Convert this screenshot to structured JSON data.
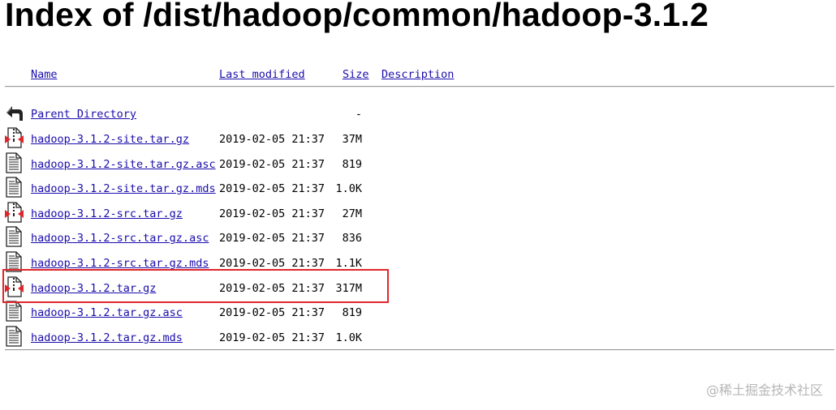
{
  "page": {
    "title": "Index of /dist/hadoop/common/hadoop-3.1.2"
  },
  "columns": {
    "name": "Name",
    "last_modified": "Last modified",
    "size": "Size",
    "description": "Description"
  },
  "parent": {
    "label": "Parent Directory",
    "size": "-",
    "icon": "back-arrow-icon"
  },
  "files": [
    {
      "name": "hadoop-3.1.2-site.tar.gz",
      "modified": "2019-02-05 21:37",
      "size": "37M",
      "icon": "compressed-file-icon"
    },
    {
      "name": "hadoop-3.1.2-site.tar.gz.asc",
      "modified": "2019-02-05 21:37",
      "size": "819",
      "icon": "text-file-icon"
    },
    {
      "name": "hadoop-3.1.2-site.tar.gz.mds",
      "modified": "2019-02-05 21:37",
      "size": "1.0K",
      "icon": "text-file-icon"
    },
    {
      "name": "hadoop-3.1.2-src.tar.gz",
      "modified": "2019-02-05 21:37",
      "size": "27M",
      "icon": "compressed-file-icon"
    },
    {
      "name": "hadoop-3.1.2-src.tar.gz.asc",
      "modified": "2019-02-05 21:37",
      "size": "836",
      "icon": "text-file-icon"
    },
    {
      "name": "hadoop-3.1.2-src.tar.gz.mds",
      "modified": "2019-02-05 21:37",
      "size": "1.1K",
      "icon": "text-file-icon"
    },
    {
      "name": "hadoop-3.1.2.tar.gz",
      "modified": "2019-02-05 21:37",
      "size": "317M",
      "icon": "compressed-file-icon"
    },
    {
      "name": "hadoop-3.1.2.tar.gz.asc",
      "modified": "2019-02-05 21:37",
      "size": "819",
      "icon": "text-file-icon"
    },
    {
      "name": "hadoop-3.1.2.tar.gz.mds",
      "modified": "2019-02-05 21:37",
      "size": "1.0K",
      "icon": "text-file-icon"
    }
  ],
  "watermark": "@稀土掘金技术社区",
  "colors": {
    "link": "#1a0dab",
    "highlight": "#e0262b"
  }
}
